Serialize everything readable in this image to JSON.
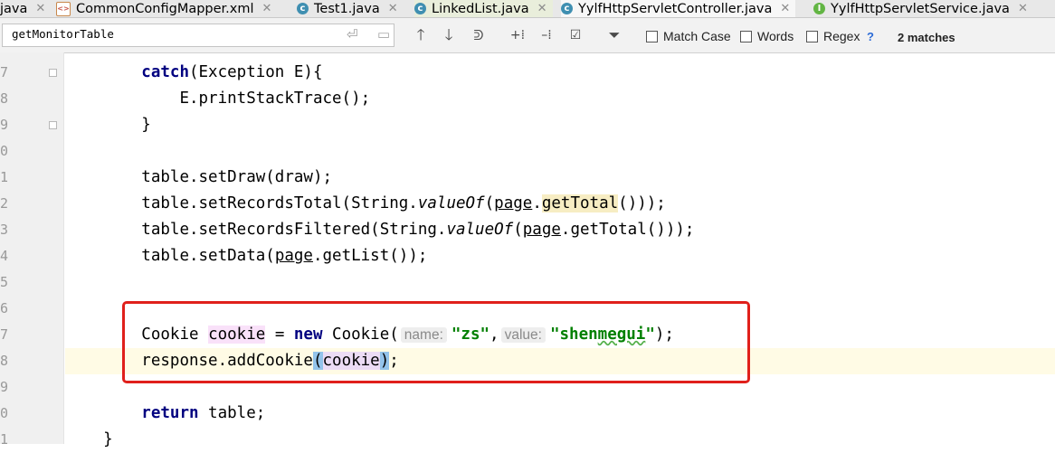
{
  "tabs": [
    {
      "label": "java",
      "icon": "none",
      "active": false,
      "show_close": true
    },
    {
      "label": "CommonConfigMapper.xml",
      "icon": "xml",
      "active": false,
      "show_close": true
    },
    {
      "label": "Test1.java",
      "icon": "C",
      "active": false,
      "show_close": true
    },
    {
      "label": "LinkedList.java",
      "icon": "C",
      "active": false,
      "show_close": true
    },
    {
      "label": "YylfHttpServletController.java",
      "icon": "C",
      "active": true,
      "show_close": true
    },
    {
      "label": "YylfHttpServletService.java",
      "icon": "I",
      "active": false,
      "show_close": true
    }
  ],
  "search": {
    "query": "getMonitorTable",
    "match_case_label": "Match Case",
    "words_label": "Words",
    "regex_label": "Regex",
    "help_label": "?",
    "match_count": "2 matches"
  },
  "gutter": {
    "line_numbers": [
      "7",
      "8",
      "9",
      "0",
      "1",
      "2",
      "3",
      "4",
      "5",
      "6",
      "7",
      "8",
      "9",
      "0",
      "1"
    ]
  },
  "code": {
    "catch_kw": "catch",
    "catch_rest": "(Exception E){",
    "print_stack": "E.printStackTrace();",
    "close_brace": "}",
    "set_draw": "table.setDraw(draw);",
    "rt_a": "table.setRecordsTotal(String.",
    "rt_b": "valueOf",
    "rt_c": "(",
    "rt_d": "page",
    "rt_e": ".",
    "rt_f": "getTotal",
    "rt_g": "()));",
    "rf_a": "table.setRecordsFiltered(String.",
    "rf_b": "valueOf",
    "rf_c": "(",
    "rf_d": "page",
    "rf_e": ".getTotal()));",
    "sd_a": "table.setData(",
    "sd_b": "page",
    "sd_c": ".getList());",
    "ck_a": "Cookie ",
    "ck_b": "cookie",
    "ck_c": " = ",
    "ck_new": "new",
    "ck_d": " Cookie(",
    "ck_hint_name": "name:",
    "ck_zs": "\"zs\"",
    "ck_comma": ",",
    "ck_hint_value": "value:",
    "ck_q1": "\"shen",
    "ck_mg": "megui",
    "ck_q2": "\"",
    "ck_end": ");",
    "ac_a": "response.addCookie",
    "ac_b": "(",
    "ac_c": "cookie",
    "ac_d": ")",
    "ac_e": ";",
    "ret_kw": "return",
    "ret_rest": " table;",
    "final_brace": "}"
  },
  "colors": {
    "keyword": "#000080",
    "string": "#008000",
    "annotation_box": "#e0201b",
    "current_line": "#fffbe5"
  }
}
